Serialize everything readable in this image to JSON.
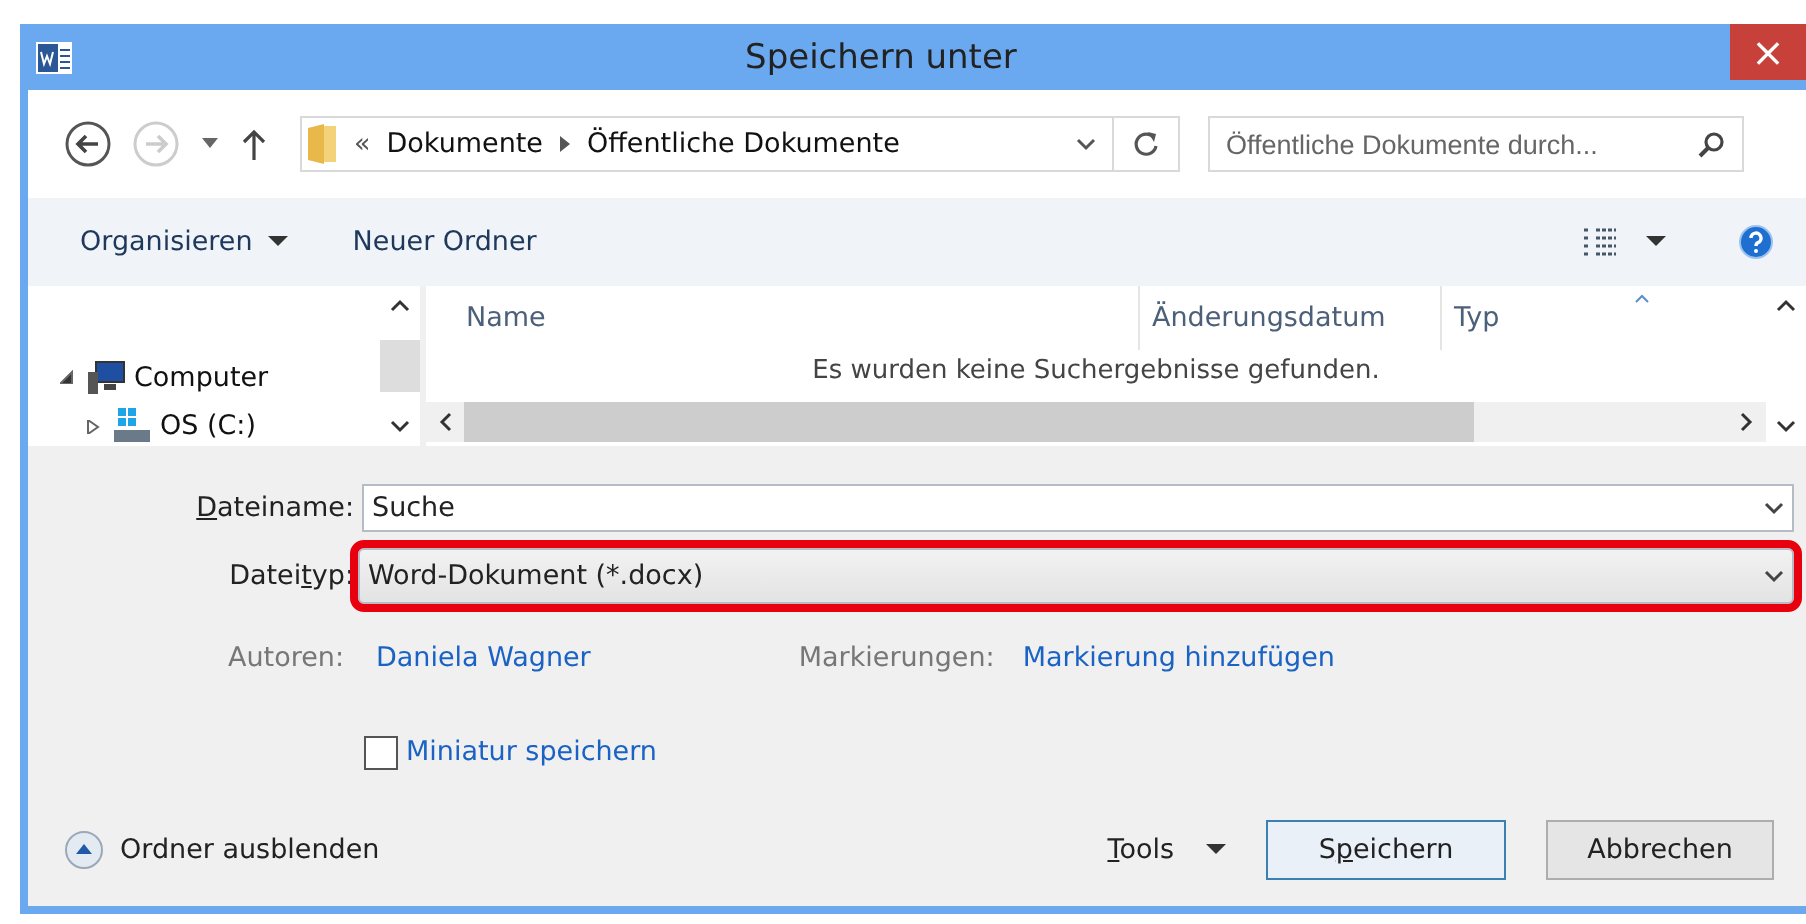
{
  "window": {
    "title": "Speichern unter",
    "close": "×"
  },
  "address_bar": {
    "prefix": "«",
    "segments": [
      "Dokumente",
      "Öffentliche Dokumente"
    ]
  },
  "search": {
    "placeholder": "Öffentliche Dokumente durch..."
  },
  "toolbar": {
    "organize": "Organisieren",
    "new_folder": "Neuer Ordner"
  },
  "tree": {
    "items": [
      {
        "label": "Computer",
        "expanded": true,
        "children": [
          {
            "label": "OS (C:)",
            "expanded": false
          }
        ]
      }
    ]
  },
  "file_list": {
    "columns": [
      "Name",
      "Änderungsdatum",
      "Typ"
    ],
    "empty_message": "Es wurden keine Suchergebnisse gefunden."
  },
  "fields": [
    {
      "label": {
        "key": "D",
        "post": "ateiname:"
      },
      "value": "Suche",
      "kind": "input",
      "highlighted": false
    },
    {
      "label": {
        "pre": "Datei",
        "key": "t",
        "post": "yp:"
      },
      "value": "Word-Dokument (*.docx)",
      "kind": "select",
      "highlighted": true
    }
  ],
  "meta": [
    {
      "label": "Autoren:",
      "value": "Daniela Wagner"
    },
    {
      "label": "Markierungen:",
      "value": "Markierung hinzufügen"
    }
  ],
  "thumbnail": {
    "label": "Miniatur speichern",
    "checked": false
  },
  "footer": {
    "hide_folders": "Ordner ausblenden",
    "tools": {
      "key": "T",
      "post": "ools"
    },
    "buttons": [
      {
        "label": {
          "pre": "S",
          "key": "p",
          "post": "eichern"
        },
        "kind": "primary"
      },
      {
        "label": {
          "post": "Abbrechen"
        },
        "kind": "secondary"
      }
    ]
  }
}
